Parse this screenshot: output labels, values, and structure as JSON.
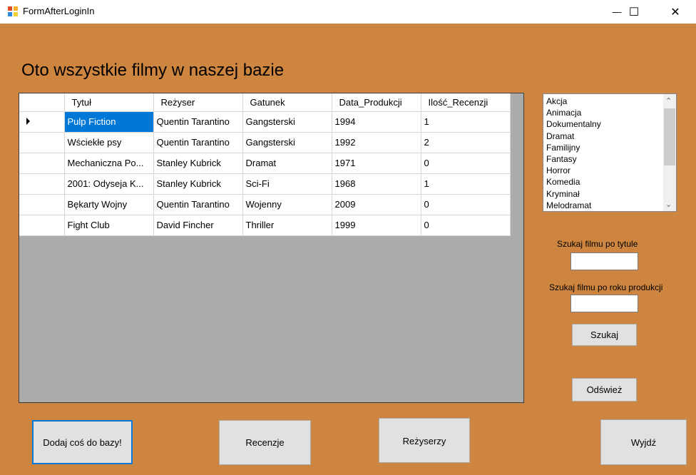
{
  "window": {
    "title": "FormAfterLoginIn",
    "minimize_glyph": "—",
    "maximize_glyph": "☐",
    "close_glyph": "✕"
  },
  "colors": {
    "background": "#cd853f",
    "selection": "#0078d7",
    "grid_empty": "#ababab"
  },
  "heading": "Oto wszystkie filmy w naszej bazie",
  "grid": {
    "columns": [
      "Tytuł",
      "Reżyser",
      "Gatunek",
      "Data_Produkcji",
      "Ilość_Recenzji"
    ],
    "rows": [
      [
        "Pulp Fiction",
        "Quentin Tarantino",
        "Gangsterski",
        "1994",
        "1"
      ],
      [
        "Wściekłe psy",
        "Quentin Tarantino",
        "Gangsterski",
        "1992",
        "2"
      ],
      [
        "Mechaniczna Po...",
        "Stanley Kubrick",
        "Dramat",
        "1971",
        "0"
      ],
      [
        "2001: Odyseja K...",
        "Stanley Kubrick",
        "Sci-Fi",
        "1968",
        "1"
      ],
      [
        "Bękarty Wojny",
        "Quentin Tarantino",
        "Wojenny",
        "2009",
        "0"
      ],
      [
        "Fight Club",
        "David Fincher",
        "Thriller",
        "1999",
        "0"
      ]
    ],
    "selected_row": 0
  },
  "genres": [
    "Akcja",
    "Animacja",
    "Dokumentalny",
    "Dramat",
    "Familijny",
    "Fantasy",
    "Horror",
    "Komedia",
    "Kryminał",
    "Melodramat"
  ],
  "search": {
    "title_label": "Szukaj filmu po tytule",
    "title_value": "",
    "year_label": "Szukaj filmu po roku produkcji",
    "year_value": "",
    "search_button": "Szukaj",
    "refresh_button": "Odśwież"
  },
  "bottom_buttons": {
    "add": "Dodaj coś do bazy!",
    "reviews": "Recenzje",
    "directors": "Reżyserzy",
    "exit": "Wyjdź"
  }
}
